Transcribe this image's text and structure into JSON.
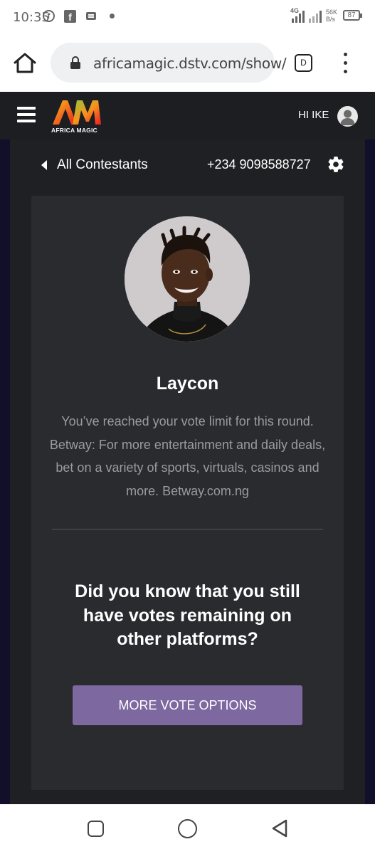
{
  "status_bar": {
    "time": "10:35",
    "network": "4G",
    "speed": "56K\nB/s",
    "battery": "87",
    "icons": [
      "facebook-circle-icon",
      "facebook-square-icon",
      "message-icon",
      "dot-icon",
      "signal-icon",
      "battery-icon"
    ]
  },
  "browser": {
    "url": "africamagic.dstv.com/show/",
    "tabs_label": "D",
    "icons": [
      "home-icon",
      "lock-icon",
      "tabs-icon",
      "more-vert-icon"
    ]
  },
  "header": {
    "logo_text": "AFRICA MAGIC",
    "greeting": "HI IKE",
    "icons": [
      "hamburger-icon",
      "user-avatar-icon"
    ]
  },
  "subnav": {
    "back_label": "All Contestants",
    "phone": "+234 9098588727",
    "icons": [
      "chevron-left-icon",
      "gear-icon"
    ]
  },
  "contestant": {
    "name": "Laycon",
    "message": "You’ve reached your vote limit for this round. Betway: For more entertainment and daily deals, bet on a variety of sports, virtuals, casinos and more. Betway.com.ng"
  },
  "promo": {
    "question": "Did you know that you still have votes remaining on other platforms?",
    "button_label": "MORE VOTE OPTIONS"
  },
  "colors": {
    "header_bg": "#1d1e22",
    "page_bg": "#120f2a",
    "card_bg": "#2a2b2f",
    "button_bg": "#7d68a0",
    "muted_text": "#9a9b9f"
  },
  "nav_bar": {
    "icons": [
      "recent-apps-icon",
      "home-circle-icon",
      "back-triangle-icon"
    ]
  }
}
